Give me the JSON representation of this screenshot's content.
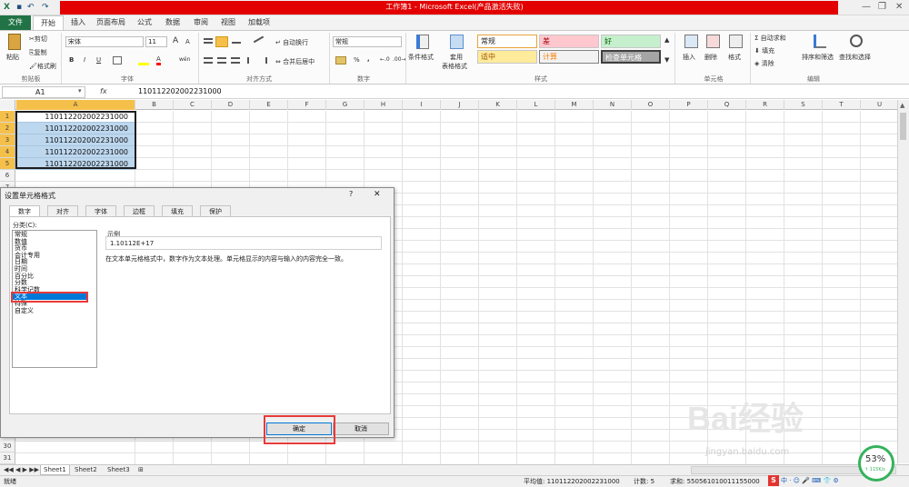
{
  "window": {
    "title": "工作簿1 - Microsoft Excel(产品激活失败)"
  },
  "tabs": [
    "文件",
    "开始",
    "插入",
    "页面布局",
    "公式",
    "数据",
    "审阅",
    "视图",
    "加载项"
  ],
  "ribbon": {
    "clipboard": {
      "paste": "粘贴",
      "cut": "剪切",
      "copy": "复制",
      "format_painter": "格式刷",
      "group": "剪贴板"
    },
    "font": {
      "name": "宋体",
      "size": "11",
      "group": "字体",
      "bold": "B",
      "italic": "I",
      "underline": "U",
      "grow": "A",
      "shrink": "A",
      "color_a": "A",
      "phonetic": "wén"
    },
    "alignment": {
      "wrap": "自动换行",
      "merge": "合并后居中",
      "group": "对齐方式"
    },
    "number": {
      "format": "常规",
      "percent": "%",
      "comma": ",",
      "group": "数字"
    },
    "styles": {
      "conditional": "条件格式",
      "table": "套用",
      "table2": "表格格式",
      "normal": "常规",
      "bad": "差",
      "good": "好",
      "neutral": "适中",
      "calc": "计算",
      "check": "检查单元格",
      "group": "样式"
    },
    "cells": {
      "insert": "插入",
      "delete": "删除",
      "format": "格式",
      "group": "单元格"
    },
    "editing": {
      "autosum": "自动求和",
      "fill": "填充",
      "clear": "清除",
      "sort": "排序和筛选",
      "find": "查找和选择",
      "group": "编辑"
    }
  },
  "formula_bar": {
    "name_box": "A1",
    "fx": "fx",
    "value": "110112202002231000"
  },
  "columns": [
    "A",
    "B",
    "C",
    "D",
    "E",
    "F",
    "G",
    "H",
    "I",
    "J",
    "K",
    "L",
    "M",
    "N",
    "O",
    "P",
    "Q",
    "R",
    "S",
    "T",
    "U"
  ],
  "rows_top": [
    "1",
    "2",
    "3",
    "4",
    "5",
    "6",
    "7"
  ],
  "rows_bottom": [
    "30",
    "31"
  ],
  "cells_a": [
    "110112202002231000",
    "110112202002231000",
    "110112202002231000",
    "110112202002231000",
    "110112202002231000"
  ],
  "dialog": {
    "title": "设置单元格格式",
    "help": "?",
    "close": "✕",
    "tabs": [
      "数字",
      "对齐",
      "字体",
      "边框",
      "填充",
      "保护"
    ],
    "category_label": "分类(C):",
    "categories": [
      "常规",
      "数值",
      "货币",
      "会计专用",
      "日期",
      "时间",
      "百分比",
      "分数",
      "科学记数",
      "文本",
      "特殊",
      "自定义"
    ],
    "selected_index": 9,
    "sample_label": "示例",
    "sample_value": "1.10112E+17",
    "description": "在文本单元格格式中，数字作为文本处理。单元格显示的内容与输入的内容完全一致。",
    "ok": "确定",
    "cancel": "取消"
  },
  "sheets": [
    "Sheet1",
    "Sheet2",
    "Sheet3"
  ],
  "status": {
    "ready": "就绪",
    "average": "平均值: 110112202002231000",
    "count": "计数: 5",
    "sum": "求和: 550561010011155000"
  },
  "watermark": {
    "brand": "Bai经验",
    "url": "jingyan.baidu.com",
    "speed": "53%",
    "net": "↑ 115K/s"
  },
  "colors": {
    "excel_green": "#217346",
    "title_red": "#e20000",
    "selection_blue": "#bdd7ee",
    "highlight_red": "#e83a3a"
  }
}
